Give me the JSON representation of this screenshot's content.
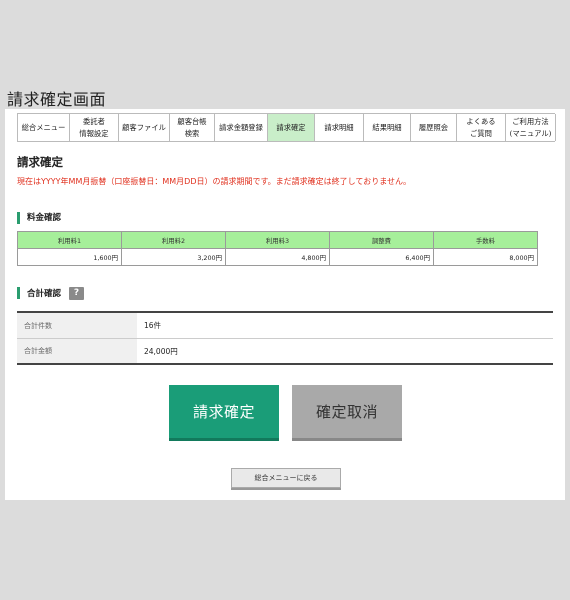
{
  "page": {
    "caption": "請求確定画面"
  },
  "nav": {
    "items": [
      {
        "line1": "総合メニュー",
        "line2": ""
      },
      {
        "line1": "委託者",
        "line2": "情報設定"
      },
      {
        "line1": "顧客ファイル",
        "line2": ""
      },
      {
        "line1": "顧客台帳",
        "line2": "検索"
      },
      {
        "line1": "請求金額登録",
        "line2": ""
      },
      {
        "line1": "請求確定",
        "line2": ""
      },
      {
        "line1": "請求明細",
        "line2": ""
      },
      {
        "line1": "結果明細",
        "line2": ""
      },
      {
        "line1": "履歴照会",
        "line2": ""
      },
      {
        "line1": "よくある",
        "line2": "ご質問"
      },
      {
        "line1": "ご利用方法",
        "line2": "(マニュアル)"
      }
    ],
    "active_index": 5,
    "active_color": "#c9eec9"
  },
  "main": {
    "title": "請求確定",
    "notice": "現在はYYYY年MM月振替（口座振替日：MM月DD日）の請求期間です。まだ請求確定は終了しておりません。",
    "notice_color": "#e0301e"
  },
  "fee_section": {
    "heading": "料金確認",
    "columns": [
      "利用料1",
      "利用料2",
      "利用料3",
      "調整費",
      "手数料"
    ],
    "values": [
      "1,600円",
      "3,200円",
      "4,800円",
      "6,400円",
      "8,000円"
    ],
    "header_color": "#a6ef9a"
  },
  "total_section": {
    "heading": "合計確認",
    "help_icon": "?",
    "rows": [
      {
        "label": "合計件数",
        "value": "16件"
      },
      {
        "label": "合計金額",
        "value": "24,000円"
      }
    ]
  },
  "actions": {
    "confirm_label": "請求確定",
    "cancel_label": "確定取消",
    "back_label": "総合メニューに戻る",
    "confirm_color": "#1a9d78",
    "cancel_color": "#a9a9a9"
  }
}
